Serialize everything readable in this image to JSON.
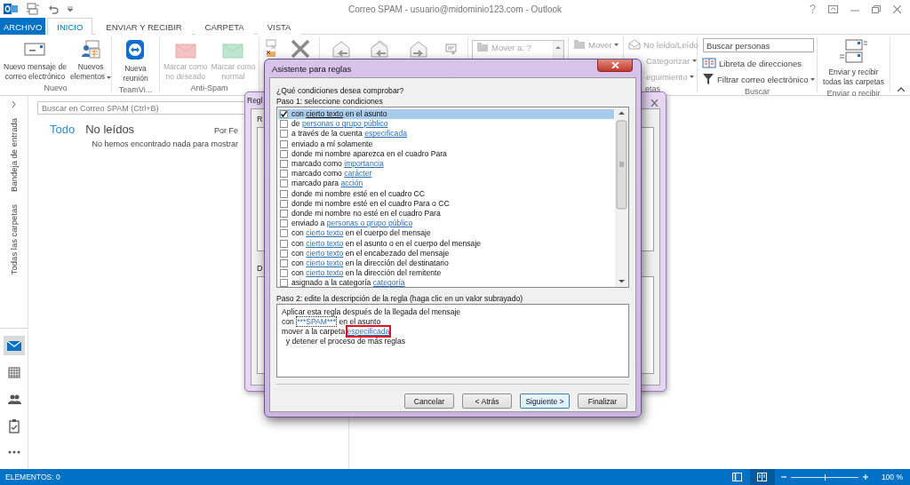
{
  "window": {
    "title": "Correo SPAM - usuario@midominio123.com - Outlook"
  },
  "ribbon_tabs": [
    {
      "label": "ARCHIVO",
      "kind": "file",
      "selected": false
    },
    {
      "label": "INICIO",
      "kind": "tab",
      "selected": true
    },
    {
      "label": "ENVIAR Y RECIBIR",
      "kind": "tab",
      "selected": false
    },
    {
      "label": "CARPETA",
      "kind": "tab",
      "selected": false
    },
    {
      "label": "VISTA",
      "kind": "tab",
      "selected": false
    }
  ],
  "ribbon_groups": [
    {
      "kind": "large",
      "label": "Nuevo",
      "items": [
        {
          "label": "Nuevo mensaje de\ncorreo electrónico",
          "dropdown": false,
          "disabled": false
        },
        {
          "label": "Nuevos\nelementos",
          "dropdown": true,
          "disabled": false
        }
      ]
    },
    {
      "kind": "large",
      "label": "TeamVi...",
      "items": [
        {
          "label": "Nueva\nreunión",
          "dropdown": false,
          "disabled": false
        }
      ]
    },
    {
      "kind": "large",
      "label": "Anti-Spam",
      "items": [
        {
          "label": "Marcar como\nno deseado",
          "dropdown": false,
          "disabled": true
        },
        {
          "label": "Marcar como\nnormal",
          "dropdown": false,
          "disabled": true
        }
      ]
    },
    {
      "kind": "quicksteps",
      "items": [
        {
          "label": "Mover a: ?"
        }
      ]
    },
    {
      "kind": "small",
      "items": [
        {
          "label": "Mover",
          "dropdown": true,
          "disabled": true
        }
      ]
    },
    {
      "kind": "small",
      "label": "etas",
      "items": [
        {
          "label": "No leído/Leído",
          "dropdown": false,
          "disabled": true
        },
        {
          "label": "Categorizar",
          "dropdown": true,
          "disabled": true
        },
        {
          "label": "eguimiento",
          "dropdown": true,
          "disabled": true
        }
      ]
    },
    {
      "kind": "search",
      "label": "Buscar",
      "placeholder": "Buscar personas",
      "items": [
        {
          "label": "Libreta de direcciones",
          "dropdown": false,
          "disabled": false
        },
        {
          "label": "Filtrar correo electrónico",
          "dropdown": true,
          "disabled": false
        }
      ]
    },
    {
      "kind": "large",
      "label": "Enviar o recibir",
      "items": [
        {
          "label": "Enviar y recibir\ntodas las carpetas",
          "dropdown": false,
          "disabled": false
        }
      ]
    }
  ],
  "nav": {
    "folders": [
      "Bandeja de entrada",
      "Todas las carpetas"
    ],
    "modules": [
      {
        "selected": true
      },
      {
        "selected": false
      },
      {
        "selected": false
      },
      {
        "selected": false
      },
      {
        "selected": false
      }
    ]
  },
  "message_list": {
    "search_placeholder": "Buscar en Correo SPAM (Ctrl+B)",
    "filters": [
      {
        "label": "Todo",
        "selected": true
      },
      {
        "label": "No leídos",
        "selected": false
      }
    ],
    "sort": "Por Fe",
    "empty_message": "No hemos encontrado nada para mostrar"
  },
  "background_dialog": {
    "title": "Regl",
    "labels": [
      "R",
      "D"
    ]
  },
  "rules_wizard": {
    "title": "Asistente para reglas",
    "question": "¿Qué condiciones desea comprobar?",
    "step1": "Paso 1: seleccione condiciones",
    "conditions": [
      {
        "checked": true,
        "selected": true,
        "parts": [
          {
            "kind": "text",
            "text": "con "
          },
          {
            "kind": "link",
            "text": "cierto texto"
          },
          {
            "kind": "text",
            "text": " en el asunto"
          }
        ]
      },
      {
        "checked": false,
        "selected": false,
        "parts": [
          {
            "kind": "text",
            "text": "de "
          },
          {
            "kind": "link",
            "text": "personas o grupo público"
          }
        ]
      },
      {
        "checked": false,
        "selected": false,
        "parts": [
          {
            "kind": "text",
            "text": "a través de la cuenta "
          },
          {
            "kind": "link",
            "text": "especificada"
          }
        ]
      },
      {
        "checked": false,
        "selected": false,
        "parts": [
          {
            "kind": "text",
            "text": "enviado a mí solamente"
          }
        ]
      },
      {
        "checked": false,
        "selected": false,
        "parts": [
          {
            "kind": "text",
            "text": "donde mi nombre aparezca en el cuadro Para"
          }
        ]
      },
      {
        "checked": false,
        "selected": false,
        "parts": [
          {
            "kind": "text",
            "text": "marcado como "
          },
          {
            "kind": "link",
            "text": "importancia"
          }
        ]
      },
      {
        "checked": false,
        "selected": false,
        "parts": [
          {
            "kind": "text",
            "text": "marcado como "
          },
          {
            "kind": "link",
            "text": "carácter"
          }
        ]
      },
      {
        "checked": false,
        "selected": false,
        "parts": [
          {
            "kind": "text",
            "text": "marcado para "
          },
          {
            "kind": "link",
            "text": "acción"
          }
        ]
      },
      {
        "checked": false,
        "selected": false,
        "parts": [
          {
            "kind": "text",
            "text": "donde mi nombre esté en el cuadro CC"
          }
        ]
      },
      {
        "checked": false,
        "selected": false,
        "parts": [
          {
            "kind": "text",
            "text": "donde mi nombre esté en el cuadro Para o CC"
          }
        ]
      },
      {
        "checked": false,
        "selected": false,
        "parts": [
          {
            "kind": "text",
            "text": "donde mi nombre no esté en el cuadro Para"
          }
        ]
      },
      {
        "checked": false,
        "selected": false,
        "parts": [
          {
            "kind": "text",
            "text": "enviado a "
          },
          {
            "kind": "link",
            "text": "personas o grupo público"
          }
        ]
      },
      {
        "checked": false,
        "selected": false,
        "parts": [
          {
            "kind": "text",
            "text": "con "
          },
          {
            "kind": "link",
            "text": "cierto texto"
          },
          {
            "kind": "text",
            "text": " en el cuerpo del mensaje"
          }
        ]
      },
      {
        "checked": false,
        "selected": false,
        "parts": [
          {
            "kind": "text",
            "text": "con "
          },
          {
            "kind": "link",
            "text": "cierto texto"
          },
          {
            "kind": "text",
            "text": " en el asunto o en el cuerpo del mensaje"
          }
        ]
      },
      {
        "checked": false,
        "selected": false,
        "parts": [
          {
            "kind": "text",
            "text": "con "
          },
          {
            "kind": "link",
            "text": "cierto texto"
          },
          {
            "kind": "text",
            "text": " en el encabezado del mensaje"
          }
        ]
      },
      {
        "checked": false,
        "selected": false,
        "parts": [
          {
            "kind": "text",
            "text": "con "
          },
          {
            "kind": "link",
            "text": "cierto texto"
          },
          {
            "kind": "text",
            "text": " en la dirección del destinatario"
          }
        ]
      },
      {
        "checked": false,
        "selected": false,
        "parts": [
          {
            "kind": "text",
            "text": "con "
          },
          {
            "kind": "link",
            "text": "cierto texto"
          },
          {
            "kind": "text",
            "text": " en la dirección del remitente"
          }
        ]
      },
      {
        "checked": false,
        "selected": false,
        "parts": [
          {
            "kind": "text",
            "text": "asignado a la categoría "
          },
          {
            "kind": "link",
            "text": "categoría"
          }
        ]
      }
    ],
    "step2": "Paso 2: edite la descripción de la regla (haga clic en un valor subrayado)",
    "description": [
      {
        "parts": [
          {
            "kind": "text",
            "text": "Aplicar esta regla después de la llegada del mensaje"
          }
        ]
      },
      {
        "parts": [
          {
            "kind": "text",
            "text": "con "
          },
          {
            "kind": "value",
            "text": "***SPAM***",
            "highlighted": false
          },
          {
            "kind": "text",
            "text": " en el asunto"
          }
        ]
      },
      {
        "parts": [
          {
            "kind": "text",
            "text": "mover a la carpeta "
          },
          {
            "kind": "link",
            "text": "especificada",
            "highlighted": true
          }
        ]
      },
      {
        "parts": [
          {
            "kind": "text",
            "text": "  y detener el proceso de más reglas"
          }
        ]
      }
    ],
    "buttons": [
      {
        "label": "Cancelar",
        "default": false
      },
      {
        "label": "< Atrás",
        "default": false
      },
      {
        "label": "Siguiente >",
        "default": true
      },
      {
        "label": "Finalizar",
        "default": false
      }
    ]
  },
  "status_bar": {
    "items": "ELEMENTOS: 0",
    "views": [
      {
        "selected": false
      },
      {
        "selected": true
      }
    ],
    "zoom": {
      "level": 0.5,
      "reading": "100 %"
    }
  }
}
